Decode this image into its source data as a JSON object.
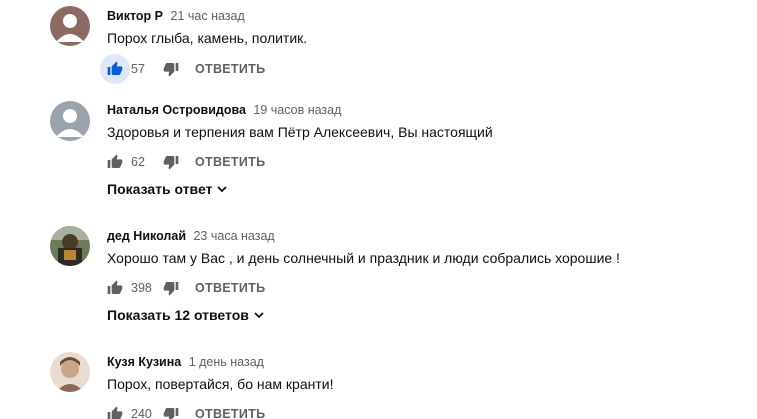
{
  "comments": [
    {
      "author": "Виктор Р",
      "time": "21 час назад",
      "text": "Порох глыба, камень, политик.",
      "likes": "57",
      "reply_label": "ОТВЕТИТЬ",
      "liked": true,
      "avatar_color": "#8a6a62"
    },
    {
      "author": "Наталья Островидова",
      "time": "19 часов назад",
      "text": "Здоровья и терпения вам  Пётр Алексеевич, Вы настоящий",
      "likes": "62",
      "reply_label": "ОТВЕТИТЬ",
      "show_replies": "Показать ответ",
      "avatar_color": "#9aa3ac"
    },
    {
      "author": "дед Николай",
      "time": "23 часа назад",
      "text": "Хорошо там у Вас , и день солнечный и праздник и люди собрались хорошие !",
      "likes": "398",
      "reply_label": "ОТВЕТИТЬ",
      "show_replies": "Показать 12 ответов",
      "avatar_color": "#5a6b4a"
    },
    {
      "author": "Кузя Кузина",
      "time": "1 день назад",
      "text": "Порох, повертайся, бо нам кранти!",
      "likes": "240",
      "reply_label": "ОТВЕТИТЬ",
      "avatar_color": "#c9a48a"
    }
  ],
  "colors": {
    "accent_like": "#065fd4",
    "icon_gray": "#606060"
  }
}
